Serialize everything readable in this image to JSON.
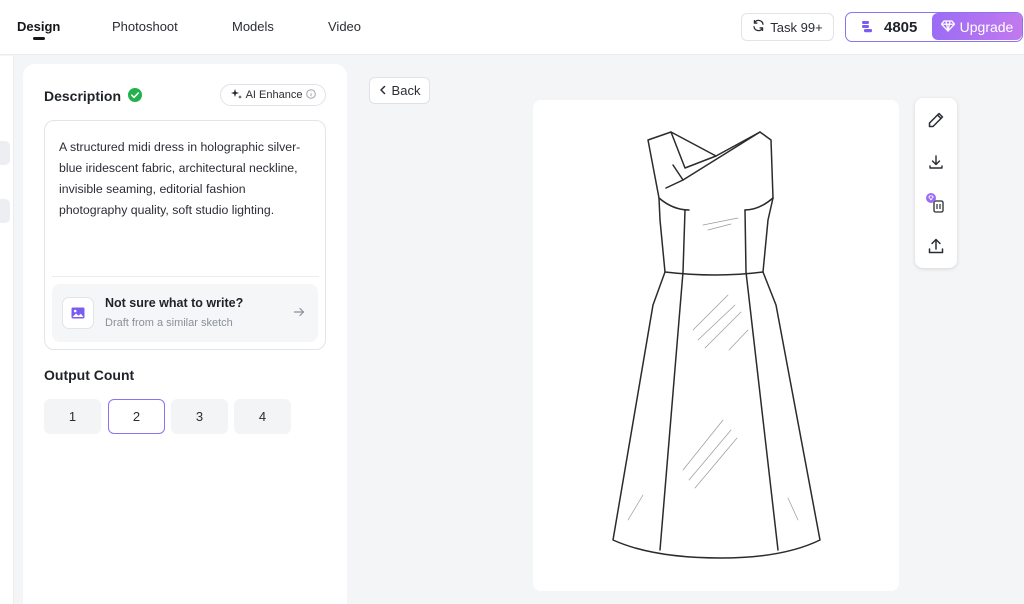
{
  "nav": {
    "tabs": [
      {
        "label": "Design",
        "active": true
      },
      {
        "label": "Photoshoot"
      },
      {
        "label": "Models"
      },
      {
        "label": "Video"
      }
    ],
    "task_label": "Task 99+",
    "credits": "4805",
    "upgrade_label": "Upgrade"
  },
  "description": {
    "title": "Description",
    "ai_enhance_label": "AI Enhance",
    "text": "A structured midi dress in holographic silver-blue iridescent fabric, architectural neckline, invisible seaming, editorial fashion photography quality, soft studio lighting.",
    "suggestion_title": "Not sure what to write?",
    "suggestion_subtitle": "Draft from a similar sketch"
  },
  "output_count": {
    "title": "Output Count",
    "options": [
      "1",
      "2",
      "3",
      "4"
    ],
    "selected": "2"
  },
  "canvas": {
    "back_label": "Back"
  },
  "icons": {
    "task": "refresh-icon",
    "credits": "coin-stack-icon",
    "upgrade": "diamond-icon",
    "verified": "check-circle-icon",
    "ai_enhance": "sparkle-icon",
    "info": "info-icon",
    "suggestion": "image-icon",
    "arrow": "arrow-right-icon",
    "back": "chevron-left-icon",
    "tools": [
      "pencil-icon",
      "download-icon",
      "delete-icon",
      "upload-icon"
    ]
  },
  "colors": {
    "accent": "#8c73f0",
    "upgrade_gradient": [
      "#9b6cf5",
      "#c279ee"
    ],
    "verified": "#22b14c"
  }
}
